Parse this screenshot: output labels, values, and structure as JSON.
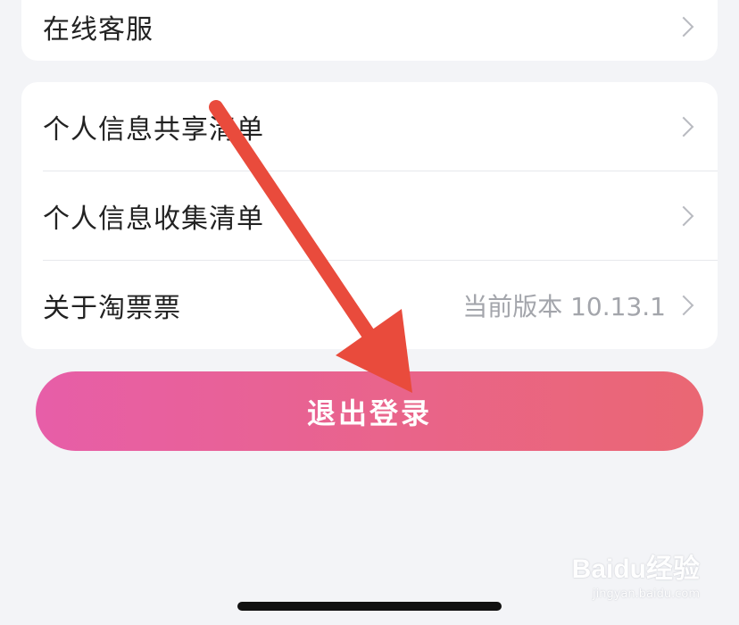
{
  "top_card": {
    "item": "在线客服"
  },
  "menu": {
    "items": [
      {
        "label": "个人信息共享清单",
        "value": ""
      },
      {
        "label": "个人信息收集清单",
        "value": ""
      },
      {
        "label": "关于淘票票",
        "value": "当前版本 10.13.1"
      }
    ]
  },
  "logout": {
    "label": "退出登录"
  },
  "annotation": {
    "arrow_color": "#e94b3c"
  },
  "watermark": {
    "brand": "Baidu经验",
    "sub": "jingyan.baidu.com"
  },
  "colors": {
    "background": "#f3f4f7",
    "button_gradient_start": "#e75ea8",
    "button_gradient_end": "#ea6773"
  }
}
